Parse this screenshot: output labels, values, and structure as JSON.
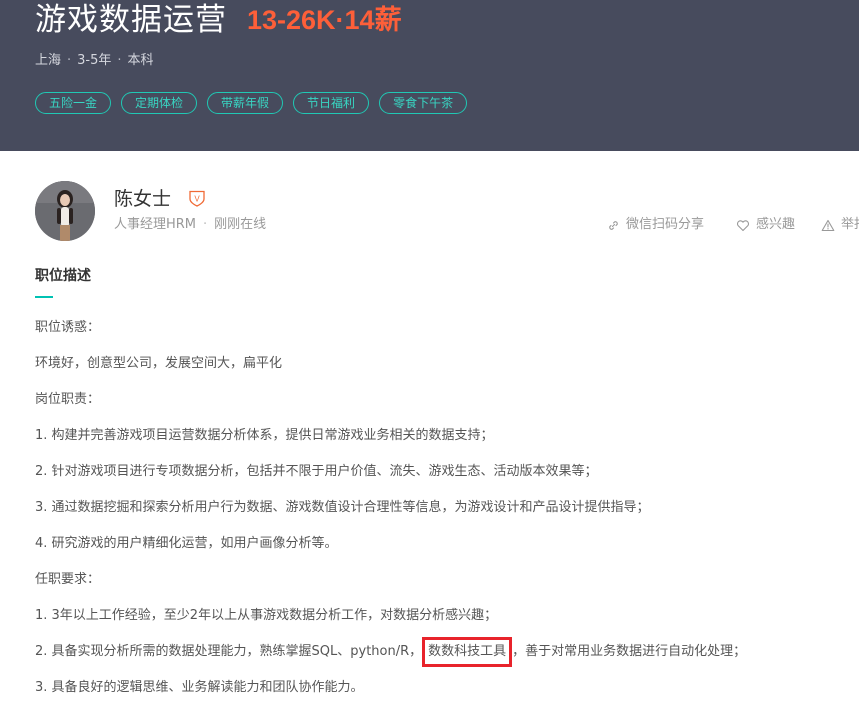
{
  "job": {
    "title": "游戏数据运营",
    "salary": "13-26K·14薪",
    "location": "上海",
    "experience": "3-5年",
    "education": "本科",
    "meta_sep": "·",
    "tags": [
      "五险一金",
      "定期体检",
      "带薪年假",
      "节日福利",
      "零食下午茶"
    ]
  },
  "recruiter": {
    "name": "陈女士",
    "badge": "V",
    "role": "人事经理HRM",
    "role_sep": "·",
    "status": "刚刚在线"
  },
  "actions": {
    "share": "微信扫码分享",
    "interest": "感兴趣",
    "report": "举报"
  },
  "section": {
    "title": "职位描述"
  },
  "description": {
    "lines": [
      "职位诱惑：",
      "环境好，创意型公司，发展空间大，扁平化",
      "岗位职责：",
      "1. 构建并完善游戏项目运营数据分析体系，提供日常游戏业务相关的数据支持；",
      "2. 针对游戏项目进行专项数据分析，包括并不限于用户价值、流失、游戏生态、活动版本效果等；",
      "3. 通过数据挖掘和探索分析用户行为数据、游戏数值设计合理性等信息，为游戏设计和产品设计提供指导；",
      "4. 研究游戏的用户精细化运营，如用户画像分析等。",
      "任职要求：",
      "1. 3年以上工作经验，至少2年以上从事游戏数据分析工作，对数据分析感兴趣；"
    ],
    "line_highlight": {
      "before": "2. 具备实现分析所需的数据处理能力，熟练掌握SQL、python/R，",
      "highlight": "数数科技工具",
      "after": "，善于对常用业务数据进行自动化处理；"
    },
    "last_line": "3. 具备良好的逻辑思维、业务解读能力和团队协作能力。"
  },
  "colors": {
    "banner": "#474b5d",
    "salary": "#fd5f39",
    "tag": "#20c8b4",
    "accent": "#00c2b3",
    "highlight_box": "#e8232b"
  }
}
